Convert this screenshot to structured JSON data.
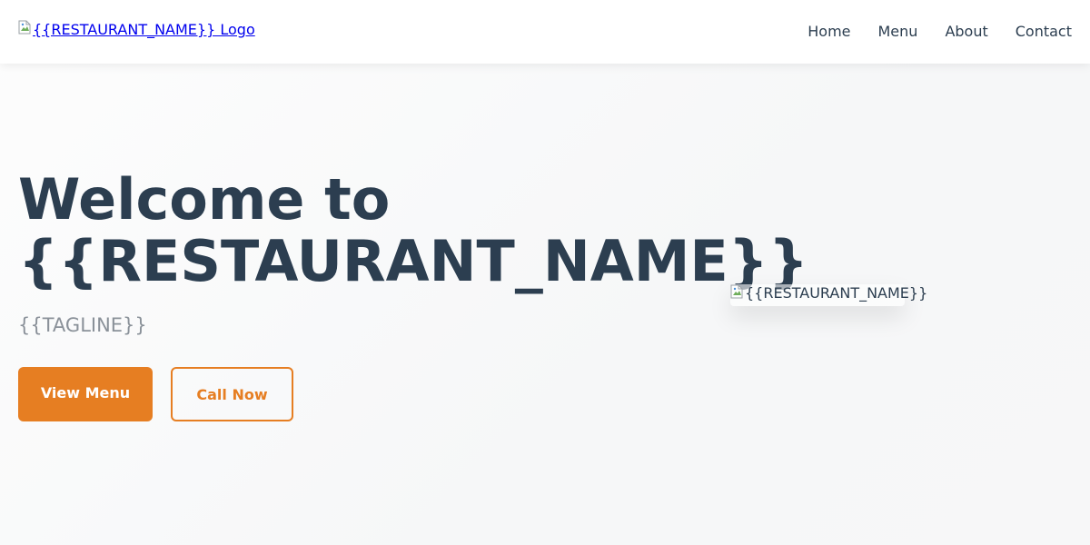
{
  "header": {
    "logo_alt": "{{RESTAURANT_NAME}} Logo",
    "nav": [
      {
        "label": "Home"
      },
      {
        "label": "Menu"
      },
      {
        "label": "About"
      },
      {
        "label": "Contact"
      }
    ]
  },
  "hero": {
    "title_line1": "Welcome to",
    "title_line2": "{{RESTAURANT_NAME}}",
    "tagline": "{{TAGLINE}}",
    "primary_button": "View Menu",
    "secondary_button": "Call Now",
    "image_alt": "{{RESTAURANT_NAME}}"
  },
  "colors": {
    "accent": "#e67e22",
    "heading": "#2c3e50",
    "tagline": "#8a9199",
    "link": "#0000ee"
  },
  "icons": {
    "broken_image": "broken-image-icon"
  }
}
